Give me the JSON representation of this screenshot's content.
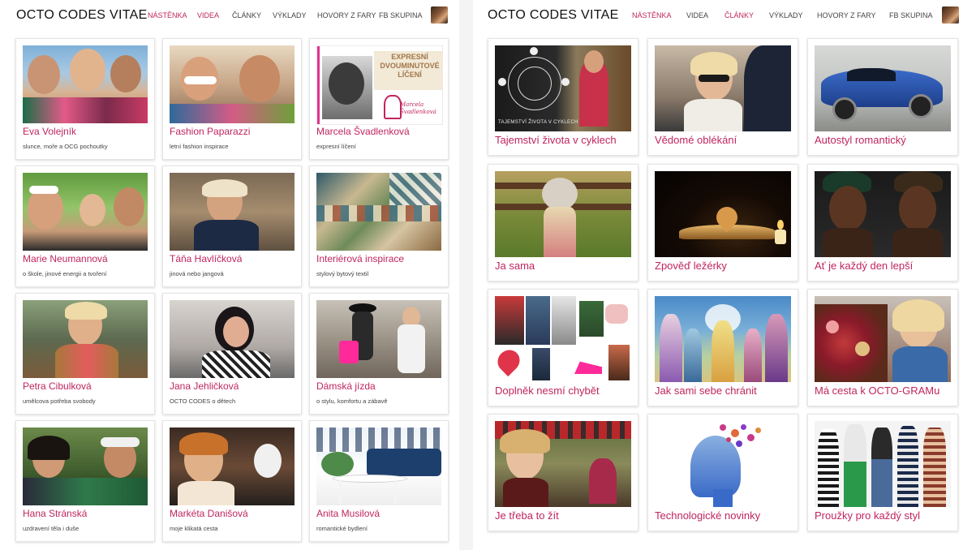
{
  "left": {
    "logo": "OCTO CODES VITAE",
    "nav": [
      "NÁSTĚNKA",
      "VIDEA",
      "ČLÁNKY",
      "VÝKLADY",
      "HOVORY Z FARY",
      "FB SKUPINA"
    ],
    "cards": [
      {
        "title": "Eva Volejník",
        "subtitle": "slunce, moře a OCG pochoutky"
      },
      {
        "title": "Fashion Paparazzi",
        "subtitle": "letní fashion inspirace"
      },
      {
        "title": "Marcela Švadlenková",
        "subtitle": "expresní líčení"
      },
      {
        "title": "Marie Neumannová",
        "subtitle": "o škole, jinové energii a tvoření"
      },
      {
        "title": "Táňa Havlíčková",
        "subtitle": "jinová nebo jangová"
      },
      {
        "title": "Interiérová inspirace",
        "subtitle": "stylový bytový textil"
      },
      {
        "title": "Petra Cibulková",
        "subtitle": "umělcova potřeba svobody"
      },
      {
        "title": "Jana Jehličková",
        "subtitle": "OCTO CODES o dětech"
      },
      {
        "title": "Dámská jízda",
        "subtitle": "o stylu, komfortu a zábavě"
      },
      {
        "title": "Hana Stránská",
        "subtitle": "uzdravení těla i duše"
      },
      {
        "title": "Markéta Danišová",
        "subtitle": "moje klikatá cesta"
      },
      {
        "title": "Anita Musilová",
        "subtitle": "romantické bydlení"
      }
    ],
    "thumb_text": {
      "expresni": "EXPRESNÍ\nDVOUMINUTOVÉ\nLÍČENÍ",
      "signature": "Marcela Švadlenková"
    }
  },
  "right": {
    "logo": "OCTO CODES VITAE",
    "nav": [
      "NÁSTĚNKA",
      "VIDEA",
      "ČLÁNKY",
      "VÝKLADY",
      "HOVORY Z FARY",
      "FB SKUPINA"
    ],
    "cards": [
      {
        "title": "Tajemství života v cyklech"
      },
      {
        "title": "Vědomé oblékání"
      },
      {
        "title": "Autostyl romantický"
      },
      {
        "title": "Ja sama"
      },
      {
        "title": "Zpověď ležérky"
      },
      {
        "title": "Ať je každý den lepší"
      },
      {
        "title": "Doplněk nesmí chybět"
      },
      {
        "title": "Jak sami sebe chránit"
      },
      {
        "title": "Má cesta k OCTO-GRAMu"
      },
      {
        "title": "Je třeba to žít"
      },
      {
        "title": "Technologické novinky"
      },
      {
        "title": "Proužky pro každý styl"
      }
    ],
    "thumb_text": {
      "cycles": "TAJEMSTVÍ ŽIVOTA V CYKLECH"
    }
  },
  "colors": {
    "accent": "#c0255e",
    "active_nav": "#c0255e",
    "text": "#111111",
    "subtitle": "#444444"
  },
  "icons": {
    "avatar": "user-avatar-photo"
  }
}
